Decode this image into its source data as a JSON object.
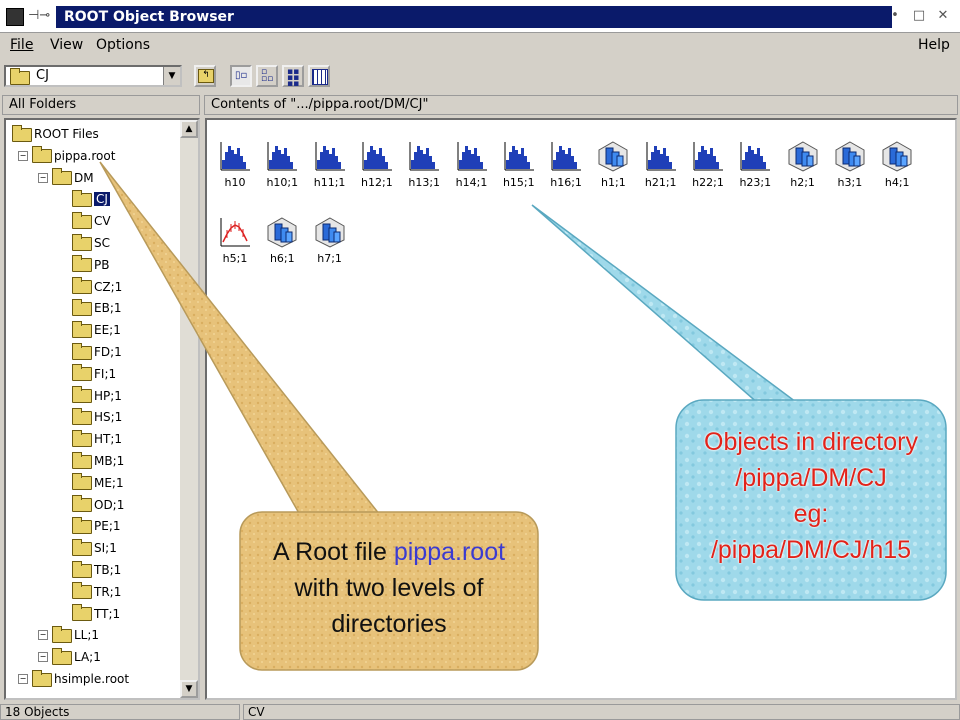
{
  "window": {
    "title": "ROOT Object Browser"
  },
  "menu": {
    "file": "File",
    "view": "View",
    "options": "Options",
    "help": "Help"
  },
  "toolbar": {
    "combo_value": "CJ"
  },
  "headers": {
    "left": "All Folders",
    "right": "Contents of \".../pippa.root/DM/CJ\""
  },
  "tree": {
    "items": [
      "ROOT Files",
      "pippa.root",
      "DM",
      "CJ",
      "CV",
      "SC",
      "PB",
      "CZ;1",
      "EB;1",
      "EE;1",
      "FD;1",
      "FI;1",
      "HP;1",
      "HS;1",
      "HT;1",
      "MB;1",
      "ME;1",
      "OD;1",
      "PE;1",
      "SI;1",
      "TB;1",
      "TR;1",
      "TT;1",
      "LL;1",
      "LA;1",
      "hsimple.root"
    ]
  },
  "objects": [
    "h10",
    "h10;1",
    "h11;1",
    "h12;1",
    "h13;1",
    "h14;1",
    "h15;1",
    "h16;1",
    "h1;1",
    "h21;1",
    "h22;1",
    "h23;1",
    "h2;1",
    "h3;1",
    "h4;1",
    "h5;1",
    "h6;1",
    "h7;1"
  ],
  "status": {
    "count": "18 Objects",
    "current": "CV"
  },
  "callouts": {
    "left": {
      "line1a": "A Root file ",
      "line1b": "pippa.root",
      "line2": "with two levels of",
      "line3": "directories"
    },
    "right": {
      "line1": "Objects in directory",
      "line2": "/pippa/DM/CJ",
      "line3": "eg:",
      "line4": "/pippa/DM/CJ/h15"
    }
  },
  "colors": {
    "title_bg": "#0a1a6a",
    "callout_left": "#e7c27a",
    "callout_right": "#9fd9ea",
    "accent_red": "#e2231a",
    "accent_blue": "#3b3bd1"
  }
}
